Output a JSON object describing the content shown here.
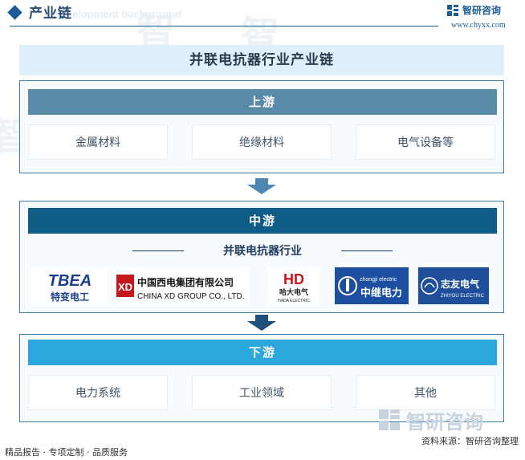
{
  "header": {
    "title": "产业链",
    "watermark_text": "Development background",
    "brand_name": "智研咨询",
    "brand_url": "www.chyxx.com"
  },
  "main_title": "并联电抗器行业产业链",
  "upstream": {
    "label": "上游",
    "items": [
      "金属材料",
      "绝缘材料",
      "电气设备等"
    ]
  },
  "midstream": {
    "label": "中游",
    "industry": "并联电抗器行业",
    "companies": [
      {
        "name": "TBEA",
        "sub": "特变电工",
        "icon": "tbea-logo"
      },
      {
        "name": "中国西电集团有限公司",
        "sub": "CHINA XD GROUP CO., LTD.",
        "mark": "XD",
        "icon": "xd-logo"
      },
      {
        "name": "哈大电气",
        "sub": "HADA ELECTRIC",
        "mark": "HD",
        "icon": "hada-logo"
      },
      {
        "name": "中继电力",
        "sub": "zhongji electric",
        "icon": "zhongji-logo"
      },
      {
        "name": "志友电气",
        "sub": "ZHIYOU ELECTRIC",
        "icon": "zhiyou-logo"
      }
    ]
  },
  "downstream": {
    "label": "下游",
    "items": [
      "电力系统",
      "工业领域",
      "其他"
    ]
  },
  "footer": {
    "left": "精品报告 · 专项定制 · 品质服务",
    "right": "资料来源：智研咨询整理",
    "watermark": "智研咨询"
  },
  "colors": {
    "upstream_bar": "#5a8caa",
    "midstream_bar": "#0f5c86",
    "downstream_bar": "#2aa8de",
    "border": "#3f7ea6",
    "title_bg": "#dff0fa",
    "brand": "#1b5c95"
  }
}
